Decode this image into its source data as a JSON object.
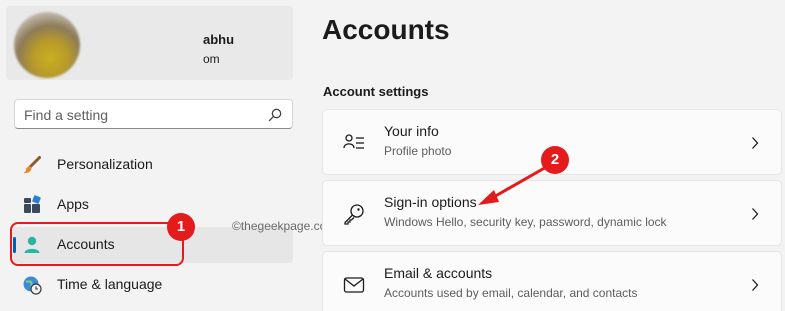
{
  "profile": {
    "name": "abhu",
    "email": "om"
  },
  "search": {
    "placeholder": "Find a setting"
  },
  "nav": {
    "items": [
      {
        "label": "Personalization",
        "icon": "paintbrush-icon"
      },
      {
        "label": "Apps",
        "icon": "apps-icon"
      },
      {
        "label": "Accounts",
        "icon": "person-icon",
        "active": true
      },
      {
        "label": "Time & language",
        "icon": "globe-clock-icon"
      }
    ]
  },
  "main": {
    "title": "Accounts",
    "section_title": "Account settings",
    "cards": [
      {
        "title": "Your info",
        "subtitle": "Profile photo",
        "icon": "user-info-icon"
      },
      {
        "title": "Sign-in options",
        "subtitle": "Windows Hello, security key, password, dynamic lock",
        "icon": "key-icon"
      },
      {
        "title": "Email & accounts",
        "subtitle": "Accounts used by email, calendar, and contacts",
        "icon": "mail-icon"
      }
    ]
  },
  "annotations": {
    "badge1": "1",
    "badge2": "2",
    "watermark": "©thegeekpage.com",
    "color": "#e51a1a"
  },
  "colors": {
    "accent": "#005fb8",
    "background": "#f3f3f3"
  }
}
